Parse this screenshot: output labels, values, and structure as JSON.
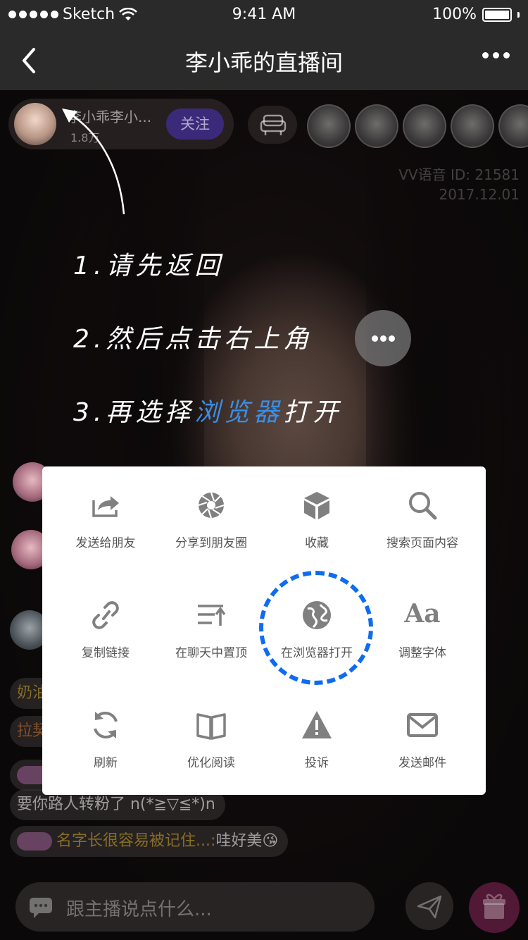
{
  "status_bar": {
    "carrier": "Sketch",
    "time": "9:41 AM",
    "battery": "100%"
  },
  "nav": {
    "title": "李小乖的直播间",
    "back_icon": "chevron-left-icon",
    "more_icon": "more-dots-icon"
  },
  "anchor": {
    "name": "李小乖李小...",
    "fans": "1.8万",
    "follow_label": "关注"
  },
  "room_info": {
    "id_line": "VV语音 ID: 21581",
    "date_line": "2017.12.01"
  },
  "guide": {
    "step1": "1.请先返回",
    "step2": "2.然后点击右上角",
    "step3_prefix": "3.再选择",
    "step3_highlight": "浏览器",
    "step3_suffix": "打开"
  },
  "chat": {
    "lines": [
      {
        "text": "要你路人转粉了 n(*≧▽≦*)n"
      },
      {
        "name": "名字长很容易被记住...:",
        "text": "哇好美😘"
      }
    ],
    "partial_1": "奶油",
    "partial_2": "拉契",
    "input_placeholder": "跟主播说点什么..."
  },
  "share_menu": {
    "items": [
      {
        "label": "发送给朋友",
        "icon": "share-forward-icon"
      },
      {
        "label": "分享到朋友圈",
        "icon": "moments-shutter-icon"
      },
      {
        "label": "收藏",
        "icon": "cube-favorite-icon"
      },
      {
        "label": "搜索页面内容",
        "icon": "search-icon"
      },
      {
        "label": "复制链接",
        "icon": "link-icon"
      },
      {
        "label": "在聊天中置顶",
        "icon": "pin-top-icon"
      },
      {
        "label": "在浏览器打开",
        "icon": "globe-icon"
      },
      {
        "label": "调整字体",
        "icon": "font-size-icon",
        "glyph": "Aa"
      },
      {
        "label": "刷新",
        "icon": "refresh-icon"
      },
      {
        "label": "优化阅读",
        "icon": "book-icon"
      },
      {
        "label": "投诉",
        "icon": "warning-icon"
      },
      {
        "label": "发送邮件",
        "icon": "mail-icon"
      }
    ]
  },
  "colors": {
    "highlight": "#3a8ee6",
    "ring": "#0f6cf0",
    "icon": "#808080"
  }
}
